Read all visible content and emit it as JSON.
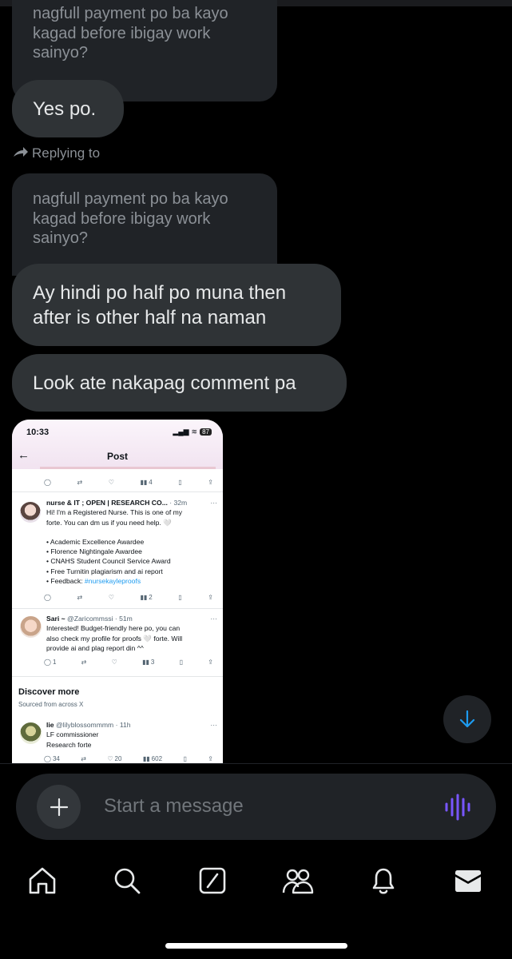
{
  "thread": {
    "quote_top": [
      "nagfull payment po ba kayo",
      "kagad before ibigay work",
      "sainyo?"
    ],
    "msg_yes": "Yes po.",
    "replying_to": "Replying to",
    "quote_reply": [
      "nagfull payment po ba kayo",
      "kagad before ibigay work",
      "sainyo?"
    ],
    "msg_half": [
      "Ay hindi po half po muna then",
      "after is other half na naman"
    ],
    "msg_look": "Look ate nakapag comment pa"
  },
  "screenshot": {
    "time": "10:33",
    "battery": "87",
    "title": "Post",
    "row1_actions": {
      "views": "4"
    },
    "tweet1": {
      "name": "nurse & IT ; OPEN | RESEARCH CO...",
      "meta": "· 32m",
      "lines": [
        "Hi! I'm a Registered Nurse. This is one of my",
        "forte. You can dm us if you need help. 🤍",
        "",
        "• Academic Excellence Awardee",
        "• Florence Nightingale Awardee",
        "• CNAHS Student Council Service Award",
        "• Free Turnitin plagiarism and ai report"
      ],
      "feedback_label": "• Feedback: ",
      "feedback_link": "#nursekayleproofs",
      "views": "2"
    },
    "tweet2": {
      "name": "Sari ~",
      "meta": "@Zaricommssi · 51m",
      "lines": [
        "Interested! Budget-friendly here po, you can",
        "also check my profile for proofs 🤍 forte. Will",
        "provide ai and plag report din ^^"
      ],
      "replies": "1",
      "views": "3"
    },
    "discover": "Discover more",
    "sourced": "Sourced from across X",
    "tweet3": {
      "name": "lie",
      "meta": "@lilyblossommmm · 11h",
      "lines": [
        "LF commissioner",
        "Research forte"
      ],
      "replies": "34",
      "likes": "20",
      "views": "602"
    }
  },
  "composer": {
    "placeholder": "Start a message"
  },
  "colors": {
    "background": "#000000",
    "bubble": "#2f3336",
    "quoted": "#202327",
    "accent": "#1d9bf0",
    "voice": "#7856ff"
  },
  "icons": [
    "reply-arrow-icon",
    "arrow-down-icon",
    "plus-icon",
    "voice-wave-icon",
    "home-icon",
    "search-icon",
    "grok-icon",
    "communities-icon",
    "bell-icon",
    "mail-icon"
  ]
}
